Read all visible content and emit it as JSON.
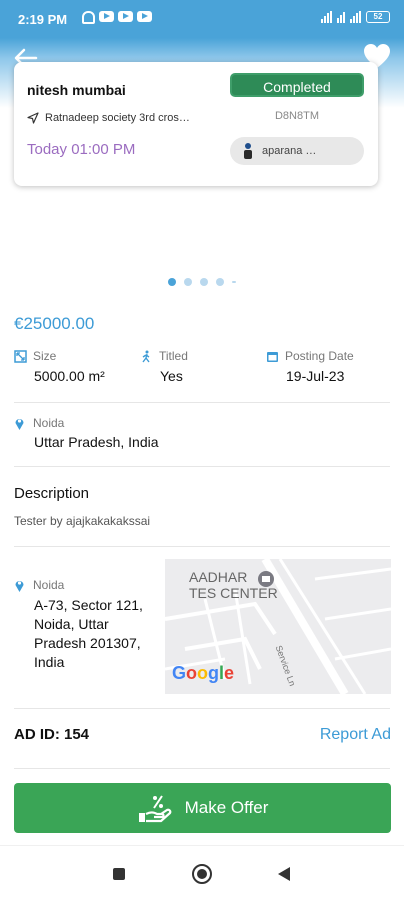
{
  "status_bar": {
    "time": "2:19 PM",
    "battery": "52",
    "icons": [
      "bell-off-icon",
      "youtube-icon",
      "youtube-icon",
      "youtube-icon",
      "signal-icon",
      "wifi-icon",
      "battery-icon"
    ]
  },
  "header": {
    "back_icon": "arrow-left-icon",
    "favorite_icon": "heart-icon"
  },
  "listing_card": {
    "name": "nitesh mumbai",
    "address": "Ratnadeep society 3rd cros…",
    "time": "Today 01:00 PM",
    "status": "Completed",
    "code": "D8N8TM",
    "user": "aparana …"
  },
  "carousel": {
    "count": 5,
    "active": 0
  },
  "price": "€25000.00",
  "stats": {
    "size_label": "Size",
    "size_value": "5000.00 m²",
    "titled_label": "Titled",
    "titled_value": "Yes",
    "posting_label": "Posting Date",
    "posting_value": "19-Jul-23"
  },
  "location": {
    "label": "Noida",
    "value": "Uttar Pradesh, India"
  },
  "description": {
    "title": "Description",
    "text": "Tester by ajajkakakakssai"
  },
  "address_block": {
    "label": "Noida",
    "value": "A-73, Sector 121, Noida, Uttar Pradesh 201307, India"
  },
  "map": {
    "place_label": "AADHAR\nTES CENTER",
    "street": "Service Ln",
    "provider": "Google"
  },
  "ad": {
    "id_text": "AD ID: 154",
    "report_label": "Report Ad"
  },
  "offer": {
    "label": "Make Offer"
  },
  "colors": {
    "accent": "#4aa3d8",
    "price": "#3d9bd6",
    "status_green": "#2e8b57",
    "offer_green": "#3aa556",
    "time_purple": "#9b6cc0"
  }
}
